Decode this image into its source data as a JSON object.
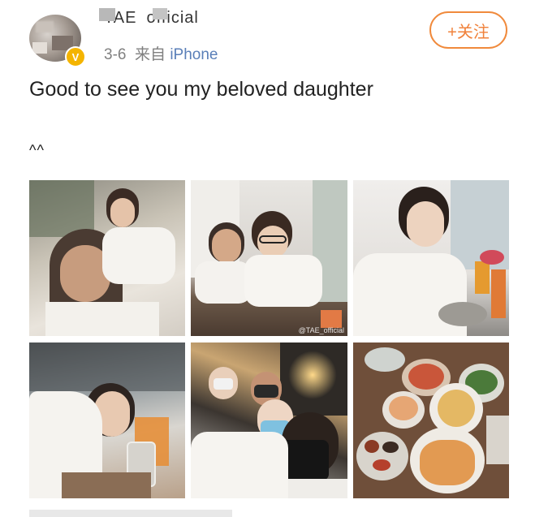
{
  "post": {
    "username": "TAE_official",
    "date": "3-6",
    "source_prefix": "来自",
    "source_device": "iPhone",
    "follow_label": "+关注",
    "verified_mark": "V",
    "text": "Good to see you my beloved daughter",
    "emote": "^^"
  },
  "photos": {
    "watermark": "@TAE_official"
  },
  "colors": {
    "follow_accent": "#f08a3c",
    "source_link": "#5a7fb8",
    "verified_badge": "#f4b400"
  },
  "icons": {
    "verified": "verified-v-icon"
  }
}
